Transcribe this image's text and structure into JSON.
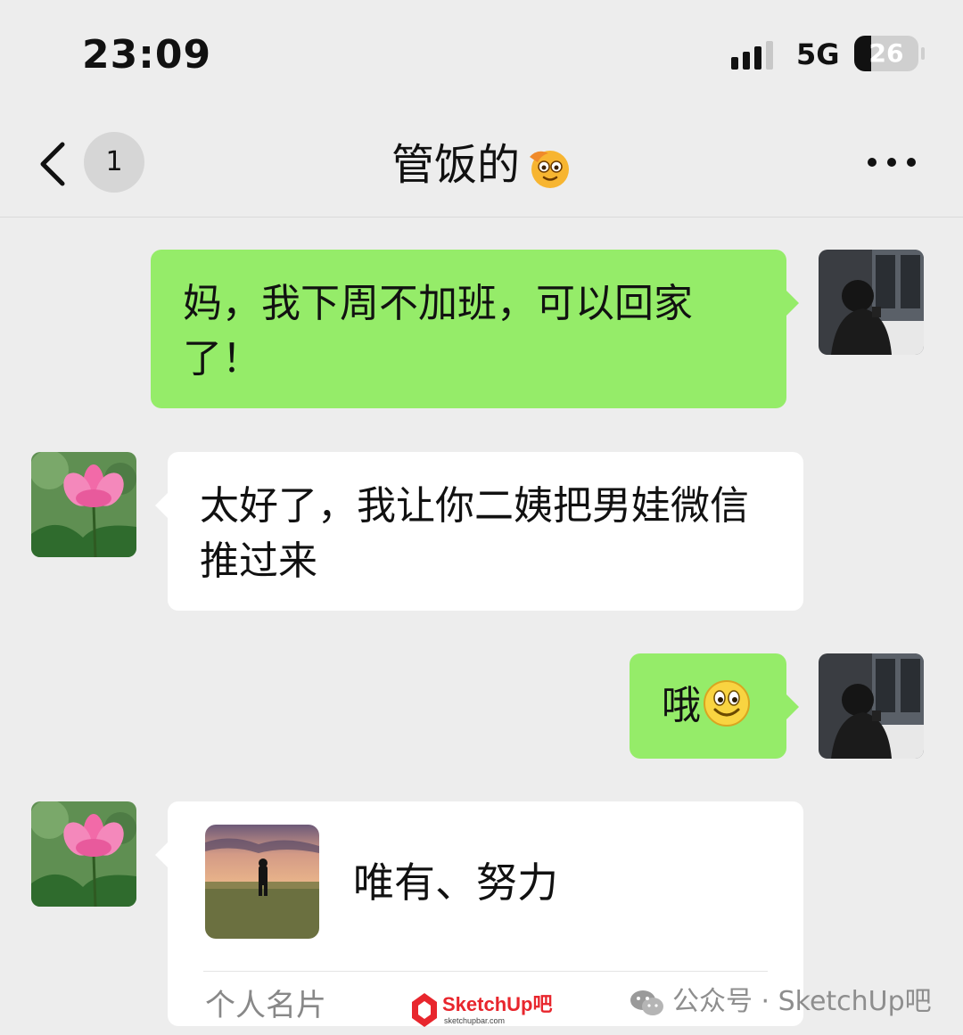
{
  "status_bar": {
    "time": "23:09",
    "network": "5G",
    "battery_level": "26"
  },
  "nav": {
    "unread_count": "1",
    "title": "管饭的",
    "title_emoji": "smiling-face-icon"
  },
  "messages": [
    {
      "side": "sent",
      "text": "妈，我下周不加班，可以回家了！"
    },
    {
      "side": "received",
      "text": "太好了，我让你二姨把男娃微信推过来"
    },
    {
      "side": "sent",
      "text": "哦",
      "emoji": "smile-emoji"
    },
    {
      "side": "received",
      "type": "contact_card",
      "name": "唯有、努力",
      "label": "个人名片"
    }
  ],
  "watermark": {
    "brand": "SketchUp吧",
    "brand_url": "sketchupbar.com",
    "account": "公众号 · SketchUp吧"
  },
  "colors": {
    "sent_bubble": "#95ec69",
    "received_bubble": "#ffffff",
    "background": "#ededed"
  }
}
